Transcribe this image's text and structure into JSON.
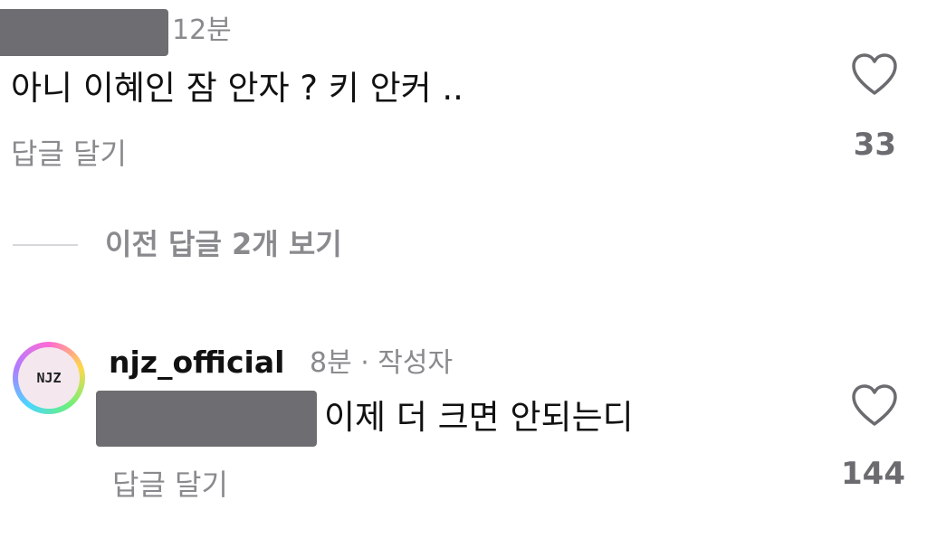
{
  "comments": [
    {
      "time": "12분",
      "text": "아니 이혜인 잠 안자 ? 키 안커 ..",
      "reply_label": "답글 달기",
      "like_count": "33"
    },
    {
      "username": "njz_official",
      "meta": "8분 · 작성자",
      "text": "이제 더 크면 안되는디",
      "reply_label": "답글 달기",
      "like_count": "144",
      "avatar_text": "NJZ"
    }
  ],
  "view_previous": "이전 답글 2개 보기",
  "icons": {
    "like": "heart-outline-icon"
  },
  "colors": {
    "secondary_text": "#8a8a8e",
    "redaction": "#6e6e72"
  }
}
